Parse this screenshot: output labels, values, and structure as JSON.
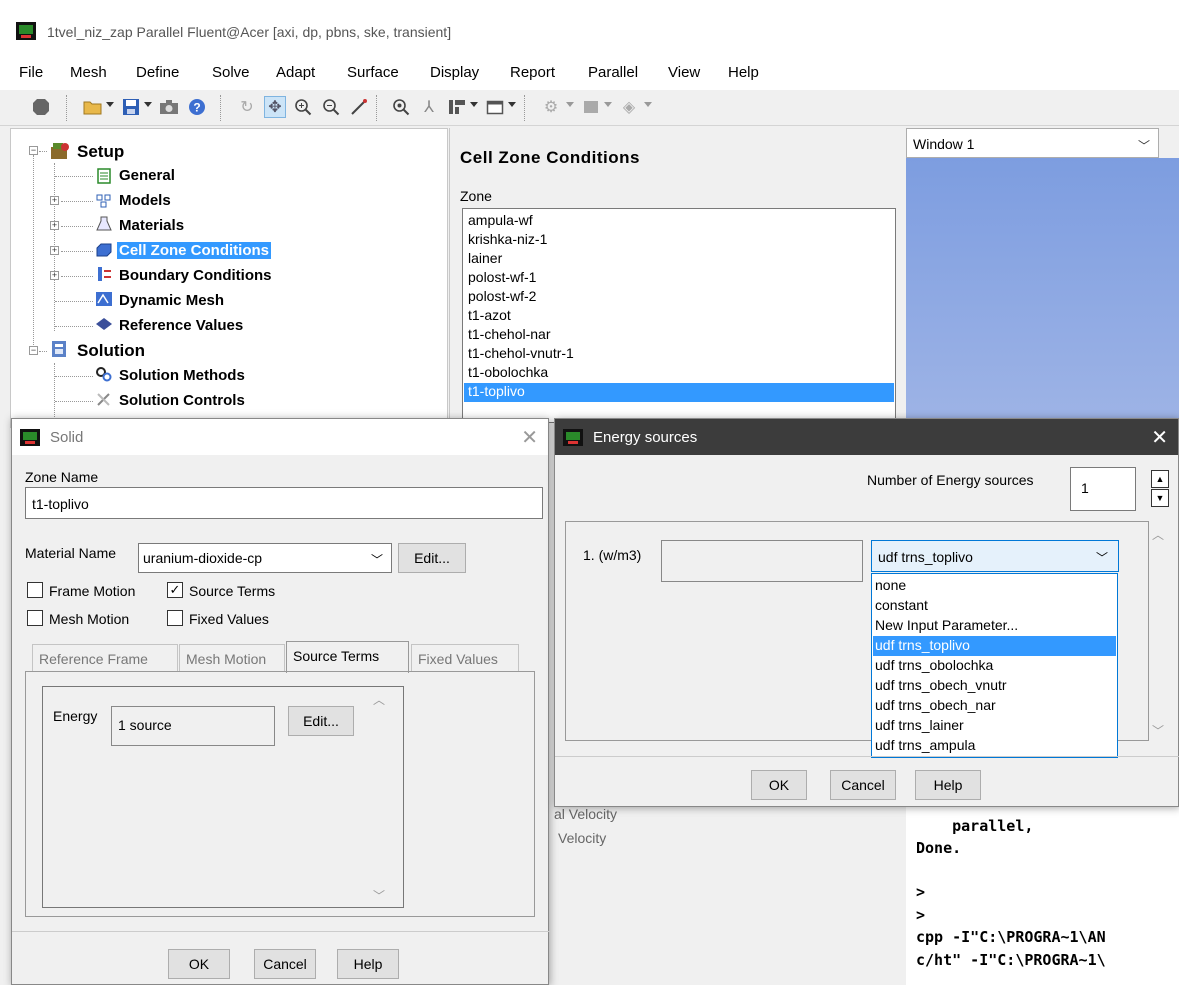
{
  "window": {
    "title": "1tvel_niz_zap Parallel Fluent@Acer  [axi, dp, pbns, ske, transient]",
    "menu": [
      "File",
      "Mesh",
      "Define",
      "Solve",
      "Adapt",
      "Surface",
      "Display",
      "Report",
      "Parallel",
      "View",
      "Help"
    ]
  },
  "tree": {
    "setup": "Setup",
    "general": "General",
    "models": "Models",
    "materials": "Materials",
    "cell_zone_conditions": "Cell Zone Conditions",
    "boundary_conditions": "Boundary Conditions",
    "dynamic_mesh": "Dynamic Mesh",
    "reference_values": "Reference Values",
    "solution": "Solution",
    "solution_methods": "Solution Methods",
    "solution_controls": "Solution Controls"
  },
  "panel": {
    "title": "Cell Zone Conditions",
    "zone_label": "Zone",
    "zones": [
      "ampula-wf",
      "krishka-niz-1",
      "lainer",
      "polost-wf-1",
      "polost-wf-2",
      "t1-azot",
      "t1-chehol-nar",
      "t1-chehol-vnutr-1",
      "t1-obolochka",
      "t1-toplivo"
    ],
    "selected_zone": "t1-toplivo",
    "partial_1": "al Velocity",
    "partial_2": "Velocity"
  },
  "graphics": {
    "window_select": "Window 1"
  },
  "console": {
    "lines": [
      "    parallel,",
      "Done.",
      "",
      ">",
      ">",
      "cpp -I\"C:\\PROGRA~1\\AN",
      "c/ht\" -I\"C:\\PROGRA~1\\"
    ]
  },
  "solid": {
    "title": "Solid",
    "zone_name_label": "Zone Name",
    "zone_name": "t1-toplivo",
    "material_label": "Material Name",
    "material_value": "uranium-dioxide-cp",
    "edit": "Edit...",
    "frame_motion": "Frame Motion",
    "source_terms": "Source Terms",
    "mesh_motion": "Mesh Motion",
    "fixed_values": "Fixed Values",
    "tabs": [
      "Reference Frame",
      "Mesh Motion",
      "Source Terms",
      "Fixed Values"
    ],
    "energy_label": "Energy",
    "energy_value": "1 source",
    "energy_edit": "Edit...",
    "ok": "OK",
    "cancel": "Cancel",
    "help": "Help"
  },
  "energy": {
    "title": "Energy sources",
    "num_label": "Number of Energy sources",
    "num_value": "1",
    "row_label": "1. (w/m3)",
    "dropdown_value": "udf trns_toplivo",
    "options": [
      "none",
      "constant",
      "New Input Parameter...",
      "udf trns_toplivo",
      "udf trns_obolochka",
      "udf trns_obech_vnutr",
      "udf trns_obech_nar",
      "udf trns_lainer",
      "udf trns_ampula"
    ],
    "selected_option": "udf trns_toplivo",
    "ok": "OK",
    "cancel": "Cancel",
    "help": "Help"
  },
  "colors": {
    "selection": "#3399ff",
    "graphics_top": "#7d9de0"
  }
}
